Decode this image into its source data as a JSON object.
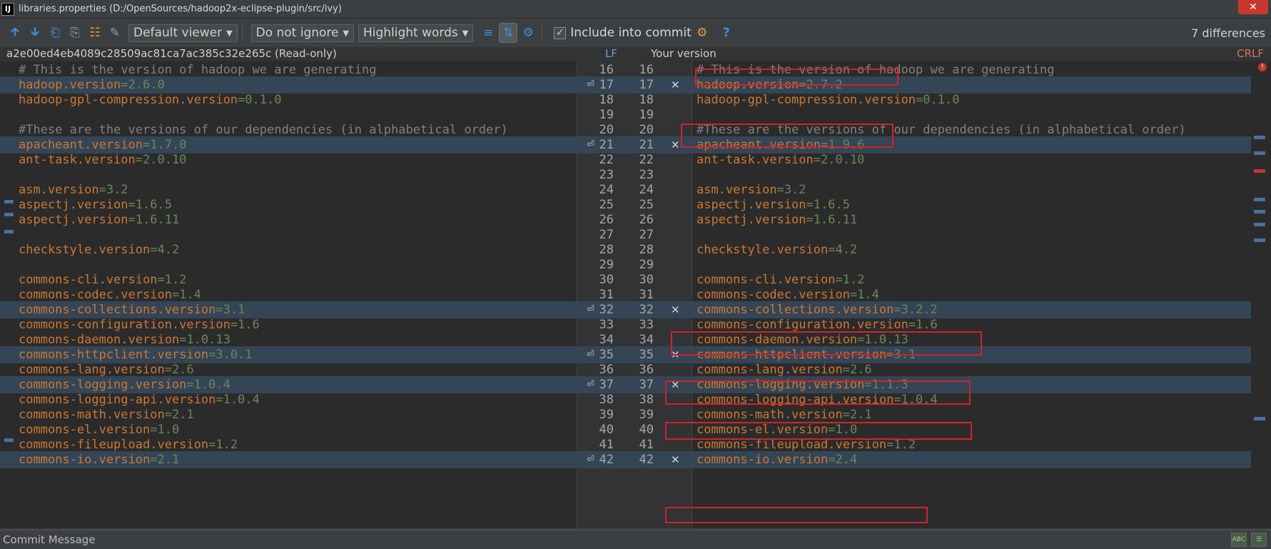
{
  "window": {
    "app_icon": "intellij-icon",
    "app_icon_text": "IJ",
    "title": "libraries.properties (D:/OpenSources/hadoop2x-eclipse-plugin/src/ivy)",
    "close_glyph": "✕"
  },
  "toolbar": {
    "viewer_label": "Default viewer",
    "ignore_label": "Do not ignore",
    "highlight_label": "Highlight words",
    "include_label": "Include into commit",
    "include_checked": true,
    "help_glyph": "?",
    "differences": "7 differences"
  },
  "header": {
    "left_revision": "a2e00ed4eb4089c28509ac81ca7ac385c32e265c (Read-only)",
    "left_separator": "LF",
    "right_title": "Your version",
    "right_separator": "CRLF"
  },
  "lines": [
    {
      "l": 16,
      "r": 16,
      "left": [
        [
          "c",
          "# This is the version of hadoop we are generating"
        ]
      ],
      "right": [
        [
          "c",
          "# This is the version of hadoop we are generating"
        ]
      ],
      "changed": false
    },
    {
      "l": 17,
      "r": 17,
      "left": [
        [
          "k",
          "hadoop.version"
        ],
        [
          "v",
          "=2.6.0"
        ]
      ],
      "right": [
        [
          "k",
          "hadoop.version"
        ],
        [
          "v",
          "=2.7.2"
        ]
      ],
      "changed": true
    },
    {
      "l": 18,
      "r": 18,
      "left": [
        [
          "k",
          "hadoop-gpl-compression.version"
        ],
        [
          "v",
          "=0.1.0"
        ]
      ],
      "right": [
        [
          "k",
          "hadoop-gpl-compression.version"
        ],
        [
          "v",
          "=0.1.0"
        ]
      ],
      "changed": false
    },
    {
      "l": 19,
      "r": 19,
      "left": [],
      "right": [],
      "changed": false
    },
    {
      "l": 20,
      "r": 20,
      "left": [
        [
          "c",
          "#These are the versions of our dependencies (in alphabetical order)"
        ]
      ],
      "right": [
        [
          "c",
          "#These are the versions of our dependencies (in alphabetical order)"
        ]
      ],
      "changed": false
    },
    {
      "l": 21,
      "r": 21,
      "left": [
        [
          "k",
          "apacheant.version"
        ],
        [
          "v",
          "=1.7.0"
        ]
      ],
      "right": [
        [
          "k",
          "apacheant.version"
        ],
        [
          "v",
          "=1.9.6"
        ]
      ],
      "changed": true
    },
    {
      "l": 22,
      "r": 22,
      "left": [
        [
          "k",
          "ant-task.version"
        ],
        [
          "v",
          "=2.0.10"
        ]
      ],
      "right": [
        [
          "k",
          "ant-task.version"
        ],
        [
          "v",
          "=2.0.10"
        ]
      ],
      "changed": false
    },
    {
      "l": 23,
      "r": 23,
      "left": [],
      "right": [],
      "changed": false
    },
    {
      "l": 24,
      "r": 24,
      "left": [
        [
          "k",
          "asm.version"
        ],
        [
          "v",
          "=3.2"
        ]
      ],
      "right": [
        [
          "k",
          "asm.version"
        ],
        [
          "v",
          "=3.2"
        ]
      ],
      "changed": false
    },
    {
      "l": 25,
      "r": 25,
      "left": [
        [
          "k",
          "aspectj.version"
        ],
        [
          "v",
          "=1.6.5"
        ]
      ],
      "right": [
        [
          "k",
          "aspectj.version"
        ],
        [
          "v",
          "=1.6.5"
        ]
      ],
      "changed": false
    },
    {
      "l": 26,
      "r": 26,
      "left": [
        [
          "k",
          "aspectj.version"
        ],
        [
          "v",
          "=1.6.11"
        ]
      ],
      "right": [
        [
          "k",
          "aspectj.version"
        ],
        [
          "v",
          "=1.6.11"
        ]
      ],
      "changed": false
    },
    {
      "l": 27,
      "r": 27,
      "left": [],
      "right": [],
      "changed": false
    },
    {
      "l": 28,
      "r": 28,
      "left": [
        [
          "k",
          "checkstyle.version"
        ],
        [
          "v",
          "=4.2"
        ]
      ],
      "right": [
        [
          "k",
          "checkstyle.version"
        ],
        [
          "v",
          "=4.2"
        ]
      ],
      "changed": false
    },
    {
      "l": 29,
      "r": 29,
      "left": [],
      "right": [],
      "changed": false
    },
    {
      "l": 30,
      "r": 30,
      "left": [
        [
          "k",
          "commons-cli.version"
        ],
        [
          "v",
          "=1.2"
        ]
      ],
      "right": [
        [
          "k",
          "commons-cli.version"
        ],
        [
          "v",
          "=1.2"
        ]
      ],
      "changed": false
    },
    {
      "l": 31,
      "r": 31,
      "left": [
        [
          "k",
          "commons-codec.version"
        ],
        [
          "v",
          "=1.4"
        ]
      ],
      "right": [
        [
          "k",
          "commons-codec.version"
        ],
        [
          "v",
          "=1.4"
        ]
      ],
      "changed": false
    },
    {
      "l": 32,
      "r": 32,
      "left": [
        [
          "k",
          "commons-collections.version"
        ],
        [
          "v",
          "=3.1"
        ]
      ],
      "right": [
        [
          "k",
          "commons-collections.version"
        ],
        [
          "v",
          "=3.2.2"
        ]
      ],
      "changed": true
    },
    {
      "l": 33,
      "r": 33,
      "left": [
        [
          "k",
          "commons-configuration.version"
        ],
        [
          "v",
          "=1.6"
        ]
      ],
      "right": [
        [
          "k",
          "commons-configuration.version"
        ],
        [
          "v",
          "=1.6"
        ]
      ],
      "changed": false
    },
    {
      "l": 34,
      "r": 34,
      "left": [
        [
          "k",
          "commons-daemon.version"
        ],
        [
          "v",
          "=1.0.13"
        ]
      ],
      "right": [
        [
          "k",
          "commons-daemon.version"
        ],
        [
          "v",
          "=1.0.13"
        ]
      ],
      "changed": false
    },
    {
      "l": 35,
      "r": 35,
      "left": [
        [
          "k",
          "commons-httpclient.version"
        ],
        [
          "v",
          "=3.0.1"
        ]
      ],
      "right": [
        [
          "k",
          "commons-httpclient.version"
        ],
        [
          "v",
          "=3.1"
        ]
      ],
      "changed": true
    },
    {
      "l": 36,
      "r": 36,
      "left": [
        [
          "k",
          "commons-lang.version"
        ],
        [
          "v",
          "=2.6"
        ]
      ],
      "right": [
        [
          "k",
          "commons-lang.version"
        ],
        [
          "v",
          "=2.6"
        ]
      ],
      "changed": false
    },
    {
      "l": 37,
      "r": 37,
      "left": [
        [
          "k",
          "commons-logging.version"
        ],
        [
          "v",
          "=1.0.4"
        ]
      ],
      "right": [
        [
          "k",
          "commons-logging.version"
        ],
        [
          "v",
          "=1.1.3"
        ]
      ],
      "changed": true
    },
    {
      "l": 38,
      "r": 38,
      "left": [
        [
          "k",
          "commons-logging-api.version"
        ],
        [
          "v",
          "=1.0.4"
        ]
      ],
      "right": [
        [
          "k",
          "commons-logging-api.version"
        ],
        [
          "v",
          "=1.0.4"
        ]
      ],
      "changed": false
    },
    {
      "l": 39,
      "r": 39,
      "left": [
        [
          "k",
          "commons-math.version"
        ],
        [
          "v",
          "=2.1"
        ]
      ],
      "right": [
        [
          "k",
          "commons-math.version"
        ],
        [
          "v",
          "=2.1"
        ]
      ],
      "changed": false
    },
    {
      "l": 40,
      "r": 40,
      "left": [
        [
          "k",
          "commons-el.version"
        ],
        [
          "v",
          "=1.0"
        ]
      ],
      "right": [
        [
          "k",
          "commons-el.version"
        ],
        [
          "v",
          "=1.0"
        ]
      ],
      "changed": false
    },
    {
      "l": 41,
      "r": 41,
      "left": [
        [
          "k",
          "commons-fileupload.version"
        ],
        [
          "v",
          "=1.2"
        ]
      ],
      "right": [
        [
          "k",
          "commons-fileupload.version"
        ],
        [
          "v",
          "=1.2"
        ]
      ],
      "changed": false
    },
    {
      "l": 42,
      "r": 42,
      "left": [
        [
          "k",
          "commons-io.version"
        ],
        [
          "v",
          "=2.1"
        ]
      ],
      "right": [
        [
          "k",
          "commons-io.version"
        ],
        [
          "v",
          "=2.4"
        ]
      ],
      "changed": true
    }
  ],
  "gutter": {
    "apply_glyph": "⏎",
    "reject_glyph": "✕"
  },
  "status": {
    "commit_message_label": "Commit Message",
    "spellcheck_icon_text": "ABC"
  },
  "colors": {
    "key": "#cc7832",
    "value": "#6a8759",
    "comment": "#808080",
    "changed_bg": "#344556",
    "annotation": "#d2232a"
  }
}
